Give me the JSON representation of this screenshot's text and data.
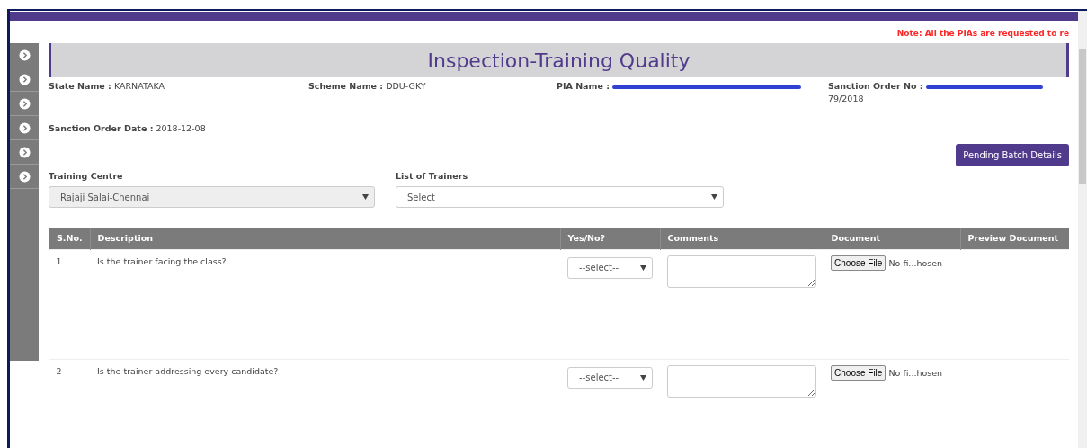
{
  "note": "Note: All the PIAs are requested to re",
  "title": "Inspection-Training Quality",
  "sidebar": {
    "items": [
      {
        "kind": "arrow"
      },
      {
        "kind": "arrow"
      },
      {
        "kind": "arrow"
      },
      {
        "kind": "arrow"
      },
      {
        "kind": "arrow"
      },
      {
        "kind": "arrow"
      }
    ]
  },
  "info": [
    {
      "label": "State Name :",
      "value": "KARNATAKA",
      "redacted": false
    },
    {
      "label": "Scheme Name :",
      "value": "DDU-GKY",
      "redacted": false
    },
    {
      "label": "PIA Name :",
      "redacted": true
    },
    {
      "label": "Sanction Order No :",
      "value": "79/2018",
      "redacted": true
    },
    {
      "label": "Sanction Order Date :",
      "value": "2018-12-08",
      "redacted": false
    }
  ],
  "pending_button": "Pending Batch Details",
  "training_centre": {
    "label": "Training Centre",
    "value": "Rajaji Salai-Chennai",
    "disabled": true
  },
  "trainers": {
    "label": "List of Trainers",
    "value": "Select",
    "disabled": false
  },
  "table": {
    "columns": [
      "S.No.",
      "Description",
      "Yes/No?",
      "Comments",
      "Document",
      "Preview Document"
    ],
    "rows": [
      {
        "sno": "1",
        "description": "Is the trainer facing the class?",
        "answer": "--select--",
        "file_button": "Choose File",
        "file_status": "No fi...hosen"
      },
      {
        "sno": "2",
        "description": "Is the trainer addressing every candidate?",
        "answer": "--select--",
        "file_button": "Choose File",
        "file_status": "No fi...hosen"
      }
    ]
  }
}
